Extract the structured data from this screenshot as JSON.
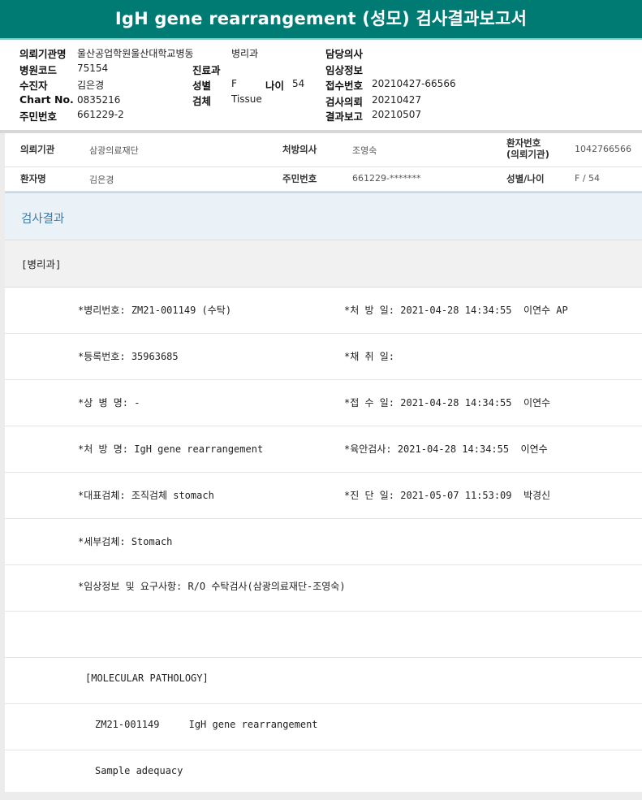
{
  "report": {
    "title": "IgH gene rearrangement (성모) 검사결과보고서"
  },
  "header": {
    "left": [
      {
        "label": "의뢰기관명",
        "value": "울산공업학원울산대학교병동"
      },
      {
        "label": "병원코드",
        "value": "75154"
      },
      {
        "label": "수진자",
        "value": "김은경"
      },
      {
        "label": "Chart No.",
        "value": "0835216"
      },
      {
        "label": "주민번호",
        "value": "661229-2"
      }
    ],
    "middle": [
      {
        "label": "",
        "value": "병리과"
      },
      {
        "label": "진료과",
        "value": ""
      },
      {
        "label": "성별",
        "value": "F"
      },
      {
        "label": "검체",
        "value": "Tissue"
      }
    ],
    "age": {
      "label": "나이",
      "value": "54"
    },
    "right": [
      {
        "label": "담당의사",
        "value": ""
      },
      {
        "label": "임상정보",
        "value": ""
      },
      {
        "label": "접수번호",
        "value": "20210427-66566"
      },
      {
        "label": "검사의뢰",
        "value": "20210427"
      },
      {
        "label": "결과보고",
        "value": "20210507"
      }
    ]
  },
  "info": {
    "row1": {
      "institution_label": "의뢰기관",
      "institution_value": "삼광의료재단",
      "doctor_label": "처방의사",
      "doctor_value": "조영숙",
      "patient_no_label_1": "환자번호",
      "patient_no_label_2": "(의뢰기관)",
      "patient_no_value": "1042766566"
    },
    "row2": {
      "name_label": "환자명",
      "name_value": "김은경",
      "ssn_label": "주민번호",
      "ssn_value": "661229-*******",
      "sexage_label": "성별/나이",
      "sexage_value": "F / 54"
    }
  },
  "results": {
    "section_title": "검사결과",
    "department": "[병리과]",
    "rows": [
      {
        "left": "*병리번호: ZM21-001149 (수탁)",
        "right": "*처 방 일: 2021-04-28 14:34:55  이연수 AP"
      },
      {
        "left": "*등록번호: 35963685",
        "right": "*채 취 일:"
      },
      {
        "left": "*상 병 명: -",
        "right": "*접 수 일: 2021-04-28 14:34:55  이연수"
      },
      {
        "left": "*처 방 명: IgH gene rearrangement",
        "right": "*육안검사: 2021-04-28 14:34:55  이연수"
      },
      {
        "left": "*대표검체: 조직검체 stomach",
        "right": "*진 단 일: 2021-05-07 11:53:09  박경신"
      },
      {
        "left": "*세부검체: Stomach",
        "right": ""
      },
      {
        "left": "*임상정보 및 요구사항: R/O 수탁검사(삼광의료재단-조영숙)",
        "right": ""
      },
      {
        "left": "",
        "right": ""
      },
      {
        "left": "[MOLECULAR PATHOLOGY]",
        "right": ""
      },
      {
        "left": "ZM21-001149     IgH gene rearrangement",
        "right": ""
      },
      {
        "left": "Sample adequacy",
        "right": ""
      }
    ]
  }
}
